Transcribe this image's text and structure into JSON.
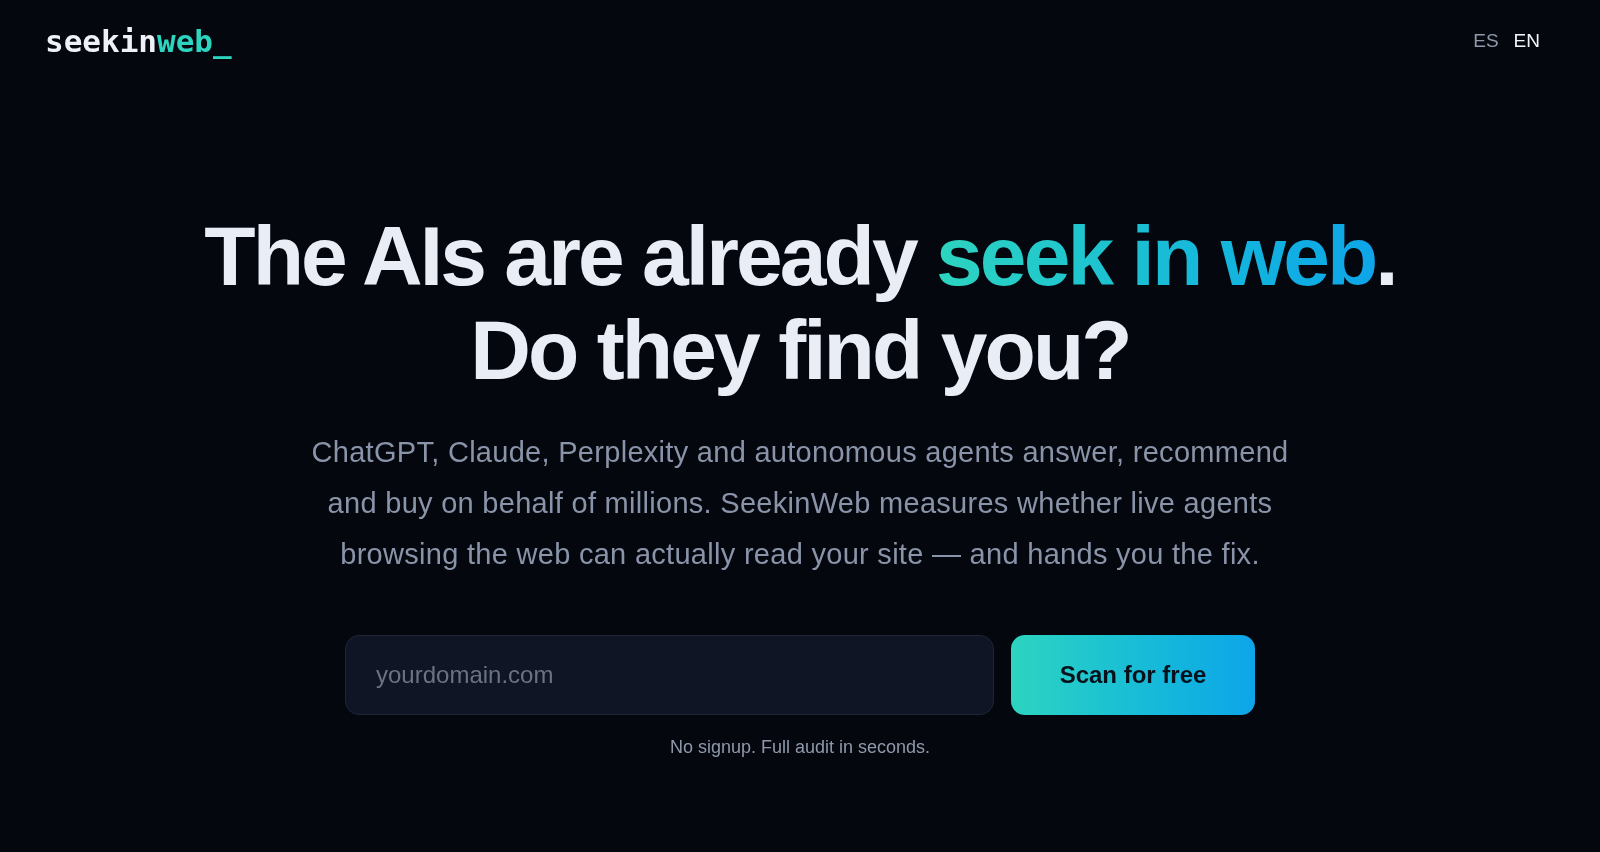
{
  "header": {
    "logo": {
      "text": "seekin",
      "accent": "web_"
    },
    "languages": [
      {
        "label": "ES",
        "selected": false
      },
      {
        "label": "EN",
        "selected": true
      }
    ]
  },
  "hero": {
    "headline": {
      "line_1": "The AIs are already ",
      "highlight": "seek in web",
      "line_1_end": ".",
      "line_2": "Do they find you?"
    },
    "description": "ChatGPT, Claude, Perplexity and autonomous agents answer, recommend and buy on behalf of millions. SeekinWeb measures whether live agents browsing the web can actually read your site — and hands you the fix.",
    "form": {
      "domain_field": {
        "placeholder": "yourdomain.com"
      },
      "submit_button": "Scan for free"
    },
    "note": "No signup. Full audit in seconds."
  }
}
